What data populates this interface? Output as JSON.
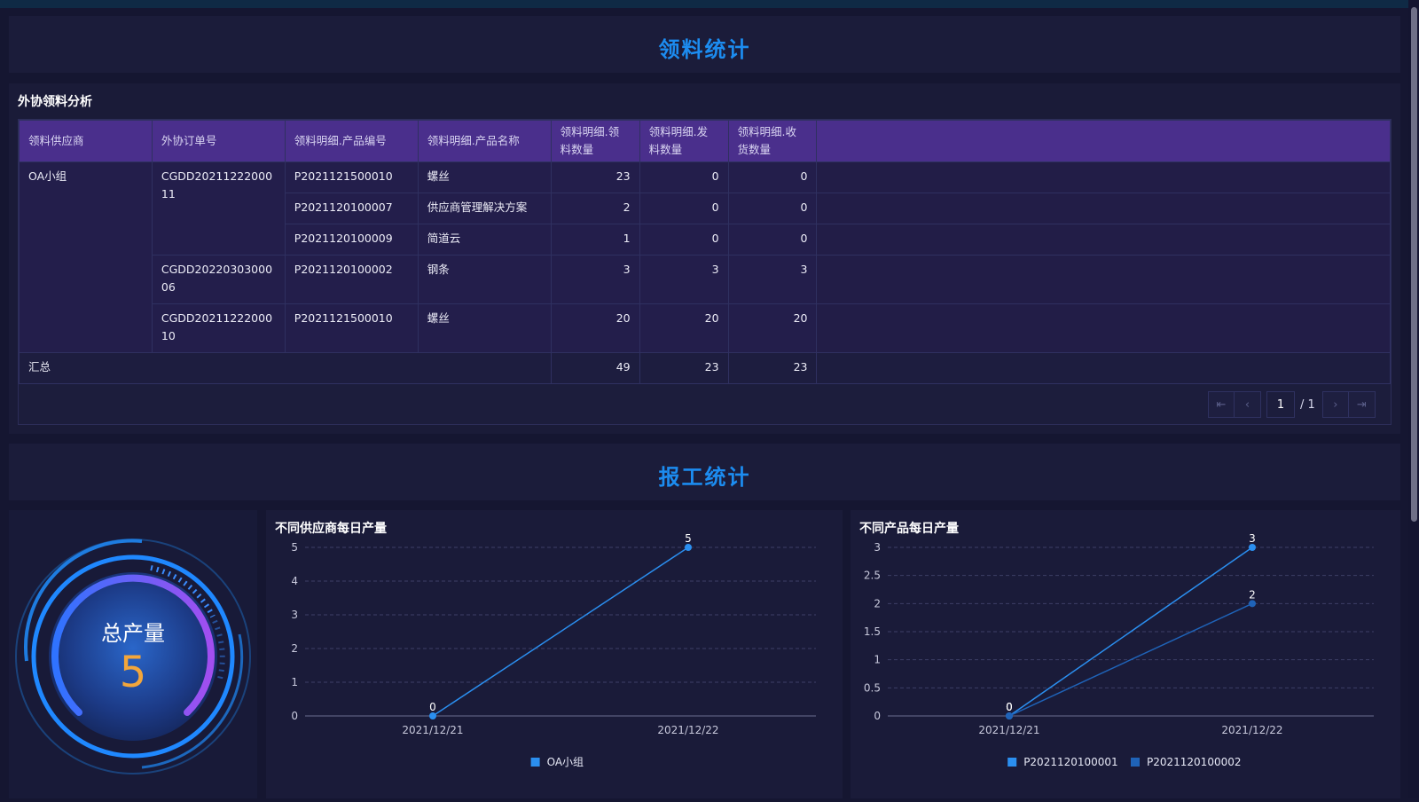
{
  "sections": {
    "material_title": "领料统计",
    "report_title": "报工统计"
  },
  "table": {
    "title": "外协领料分析",
    "headers": [
      "领料供应商",
      "外协订单号",
      "领料明细.产品编号",
      "领料明细.产品名称",
      "领料明细.领料数量",
      "领料明细.发料数量",
      "领料明细.收货数量"
    ],
    "rows": [
      {
        "supplier": "OA小组",
        "order": "CGDD2021122200011",
        "code": "P2021121500010",
        "name": "螺丝",
        "qty": "23",
        "issued": "0",
        "received": "0"
      },
      {
        "code": "P2021120100007",
        "name": "供应商管理解决方案",
        "qty": "2",
        "issued": "0",
        "received": "0"
      },
      {
        "code": "P2021120100009",
        "name": "简道云",
        "qty": "1",
        "issued": "0",
        "received": "0"
      },
      {
        "order": "CGDD2022030300006",
        "code": "P2021120100002",
        "name": "钢条",
        "qty": "3",
        "issued": "3",
        "received": "3"
      },
      {
        "order": "CGDD2021122200010",
        "code": "P2021121500010",
        "name": "螺丝",
        "qty": "20",
        "issued": "20",
        "received": "20"
      }
    ],
    "total": {
      "label": "汇总",
      "qty": "49",
      "issued": "23",
      "received": "23"
    }
  },
  "pager": {
    "current": "1",
    "total": "/ 1"
  },
  "gauge": {
    "label": "总产量",
    "value": "5"
  },
  "chart_data": [
    {
      "type": "line",
      "title": "不同供应商每日产量",
      "x": [
        "2021/12/21",
        "2021/12/22"
      ],
      "ylim": [
        0,
        5
      ],
      "yticks": [
        0,
        1,
        2,
        3,
        4,
        5
      ],
      "grid": true,
      "legend": "bottom",
      "series": [
        {
          "name": "OA小组",
          "values": [
            0,
            5
          ],
          "color": "#2b8ff0"
        }
      ]
    },
    {
      "type": "line",
      "title": "不同产品每日产量",
      "x": [
        "2021/12/21",
        "2021/12/22"
      ],
      "ylim": [
        0,
        3
      ],
      "yticks": [
        0,
        0.5,
        1,
        1.5,
        2,
        2.5,
        3
      ],
      "grid": true,
      "legend": "bottom",
      "series": [
        {
          "name": "P2021120100001",
          "values": [
            0,
            3
          ],
          "color": "#2b8ff0"
        },
        {
          "name": "P2021120100002",
          "values": [
            0,
            2
          ],
          "color": "#1f63b8"
        }
      ]
    }
  ]
}
